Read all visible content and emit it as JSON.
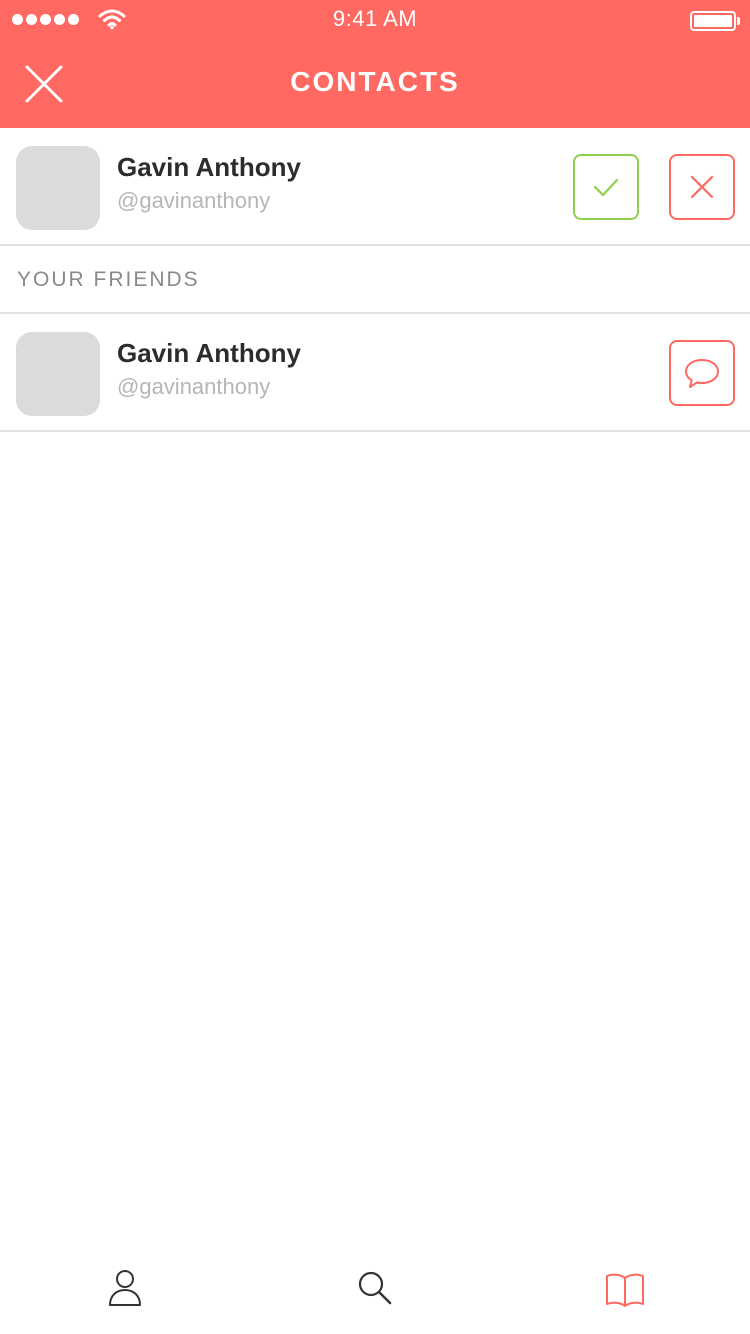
{
  "status_bar": {
    "time": "9:41 AM",
    "signal_icon": "signal-dots-icon",
    "wifi_icon": "wifi-icon",
    "battery_icon": "battery-icon"
  },
  "header": {
    "title": "CONTACTS",
    "close_icon": "close-icon",
    "background_color": "#ff6961"
  },
  "pending_request": {
    "name": "Gavin Anthony",
    "handle": "@gavinanthony",
    "accept_icon": "check-icon",
    "decline_icon": "close-icon",
    "accept_color": "#8fcf4d",
    "decline_color": "#ff6961"
  },
  "friends_section": {
    "label": "YOUR FRIENDS",
    "friends": [
      {
        "name": "Gavin Anthony",
        "handle": "@gavinanthony",
        "action_icon": "chat-bubble-icon"
      }
    ]
  },
  "tab_bar": {
    "tabs": [
      {
        "icon": "user-icon",
        "active": false
      },
      {
        "icon": "search-icon",
        "active": false
      },
      {
        "icon": "book-icon",
        "active": true
      }
    ],
    "active_color": "#ff6961",
    "inactive_color": "#333333"
  }
}
